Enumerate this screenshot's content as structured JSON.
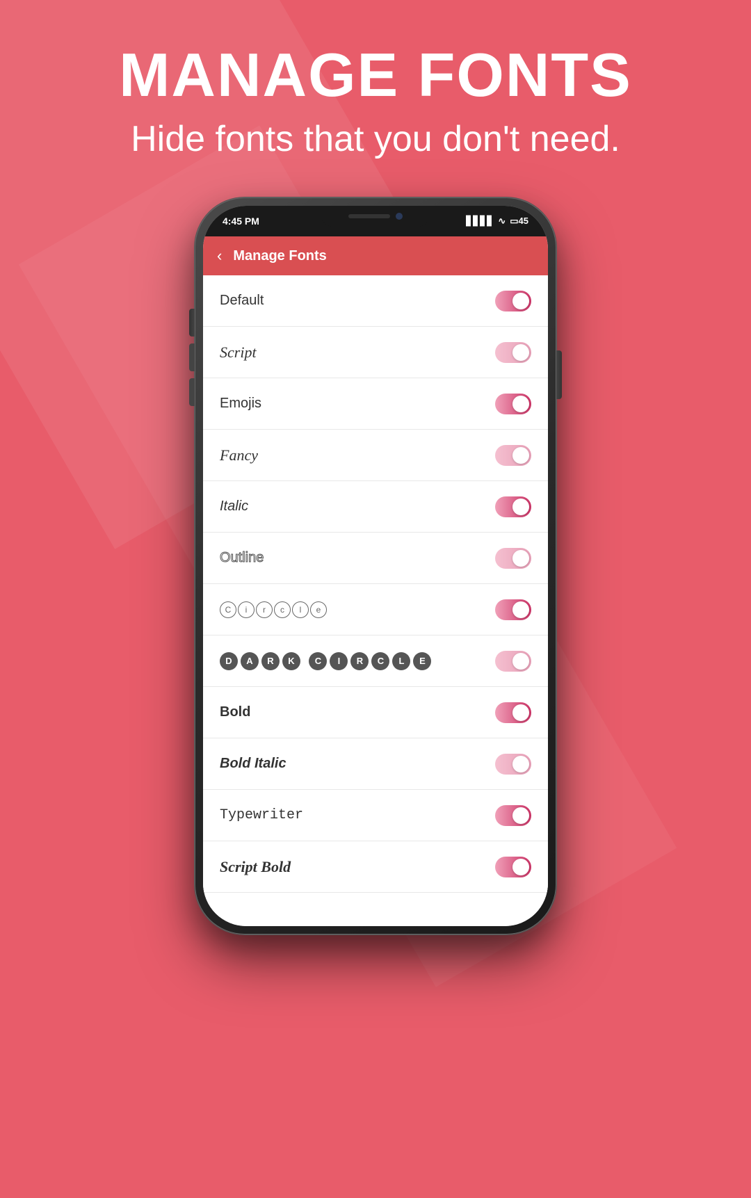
{
  "background": {
    "color": "#e85c6a"
  },
  "header": {
    "main_title": "MANAGE FONTS",
    "sub_title": "Hide fonts that you don't need."
  },
  "status_bar": {
    "time": "4:45 PM",
    "signal": "▋▋▋▋",
    "wifi": "WiFi",
    "battery": "45"
  },
  "app_bar": {
    "back_label": "‹",
    "title": "Manage Fonts"
  },
  "font_items": [
    {
      "name": "Default",
      "style": "default",
      "enabled": true
    },
    {
      "name": "Script",
      "style": "script",
      "enabled": true
    },
    {
      "name": "Emojis",
      "style": "default",
      "enabled": true
    },
    {
      "name": "Fancy",
      "style": "fancy",
      "enabled": true
    },
    {
      "name": "Italic",
      "style": "italic",
      "enabled": true
    },
    {
      "name": "Outline",
      "style": "outline",
      "enabled": true
    },
    {
      "name": "Circle",
      "style": "circle-light",
      "enabled": true
    },
    {
      "name": "DARK CIRCLE",
      "style": "dark-circle",
      "enabled": true
    },
    {
      "name": "Bold",
      "style": "bold",
      "enabled": true
    },
    {
      "name": "Bold Italic",
      "style": "bold-italic",
      "enabled": true
    },
    {
      "name": "Typewriter",
      "style": "typewriter",
      "enabled": true
    },
    {
      "name": "Script Bold",
      "style": "script-bold",
      "enabled": true
    }
  ]
}
